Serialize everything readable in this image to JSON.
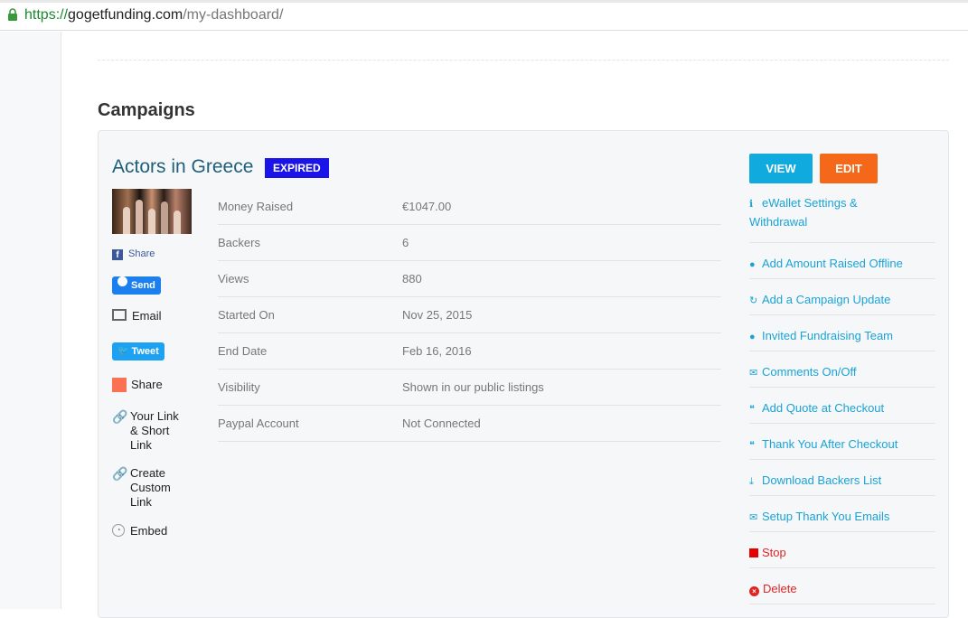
{
  "browser": {
    "url_scheme": "https://",
    "url_host": "gogetfunding.com",
    "url_path": "/my-dashboard/"
  },
  "page": {
    "section_title": "Campaigns"
  },
  "campaign": {
    "title": "Actors in Greece",
    "status_badge": "EXPIRED",
    "share": {
      "facebook": "Share",
      "messenger": "Send",
      "email": "Email",
      "twitter": "Tweet",
      "share": "Share",
      "your_link_lines": [
        "Your Link",
        "& Short",
        "Link"
      ],
      "custom_link_lines": [
        "Create",
        "Custom",
        "Link"
      ],
      "embed": "Embed"
    },
    "details": [
      {
        "label": "Money Raised",
        "value": "€1047.00"
      },
      {
        "label": "Backers",
        "value": "6"
      },
      {
        "label": "Views",
        "value": "880"
      },
      {
        "label": "Started On",
        "value": "Nov 25, 2015"
      },
      {
        "label": "End Date",
        "value": "Feb 16, 2016"
      },
      {
        "label": "Visibility",
        "value": "Shown in our public listings"
      },
      {
        "label": "Paypal Account",
        "value": "Not Connected"
      }
    ],
    "buttons": {
      "view": "VIEW",
      "edit": "EDIT"
    },
    "actions": [
      {
        "icon": "info-icon",
        "glyph": "ℹ",
        "lines": [
          "eWallet Settings &",
          "Withdrawal"
        ]
      },
      {
        "icon": "money-bag-icon",
        "glyph": "●",
        "lines": [
          "Add Amount Raised Offline"
        ]
      },
      {
        "icon": "refresh-icon",
        "glyph": "↻",
        "lines": [
          "Add a Campaign Update"
        ]
      },
      {
        "icon": "user-icon",
        "glyph": "●",
        "lines": [
          "Invited Fundraising Team"
        ]
      },
      {
        "icon": "envelope-icon",
        "glyph": "✉",
        "lines": [
          "Comments On/Off"
        ]
      },
      {
        "icon": "quote-icon",
        "glyph": "❝",
        "lines": [
          "Add Quote at Checkout"
        ]
      },
      {
        "icon": "quote-icon",
        "glyph": "❝",
        "lines": [
          "Thank You After Checkout"
        ]
      },
      {
        "icon": "download-icon",
        "glyph": "⤓",
        "lines": [
          "Download Backers List"
        ]
      },
      {
        "icon": "envelope-icon",
        "glyph": "✉",
        "lines": [
          "Setup Thank You Emails"
        ]
      },
      {
        "icon": "stop-icon",
        "lines": [
          "Stop"
        ],
        "color": "#e02424"
      },
      {
        "icon": "delete-icon",
        "lines": [
          "Delete"
        ],
        "color": "#e02424"
      }
    ]
  }
}
